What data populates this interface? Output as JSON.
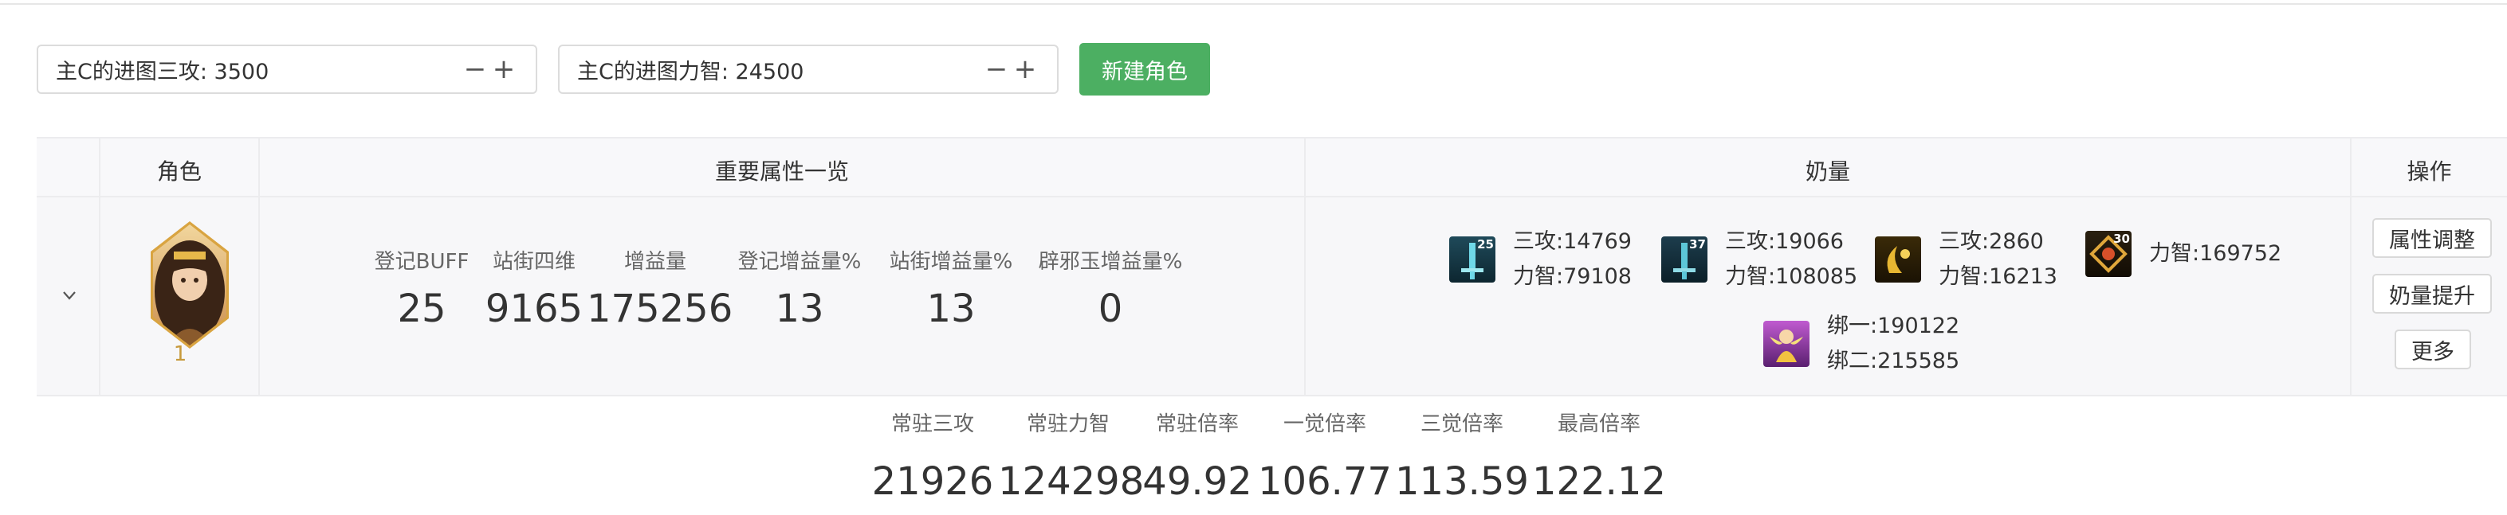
{
  "toolbar": {
    "main_attack_field": {
      "label": "主C的进图三攻: 3500",
      "minus": "−",
      "plus": "+"
    },
    "main_stat_field": {
      "label": "主C的进图力智: 24500",
      "minus": "−",
      "plus": "+"
    },
    "new_role_button": "新建角色",
    "accent_color": "#4caf62"
  },
  "table": {
    "headers": {
      "role": "角色",
      "attributes": "重要属性一览",
      "milk": "奶量",
      "operations": "操作"
    },
    "row": {
      "role_index": "1",
      "stats": [
        {
          "label": "登记BUFF",
          "value": "25"
        },
        {
          "label": "站街四维",
          "value": "9165"
        },
        {
          "label": "增益量",
          "value": "175256"
        },
        {
          "label": "登记增益量%",
          "value": "13"
        },
        {
          "label": "站街增益量%",
          "value": "13"
        },
        {
          "label": "辟邪玉增益量%",
          "value": "0"
        }
      ],
      "milk": {
        "skill1": {
          "level": "25",
          "line1": "三攻:14769",
          "line2": "力智:79108"
        },
        "skill2": {
          "level": "37",
          "line1": "三攻:19066",
          "line2": "力智:108085"
        },
        "skill3": {
          "line1": "三攻:2860",
          "line2": "力智:16213"
        },
        "skill4": {
          "level": "30",
          "line1": "力智:169752"
        },
        "skill5": {
          "line1": "绑一:190122",
          "line2": "绑二:215585"
        }
      },
      "operations": {
        "adjust": "属性调整",
        "boost": "奶量提升",
        "more": "更多"
      }
    }
  },
  "summary": [
    {
      "label": "常驻三攻",
      "value": "21926"
    },
    {
      "label": "常驻力智",
      "value": "124298"
    },
    {
      "label": "常驻倍率",
      "value": "49.92"
    },
    {
      "label": "一觉倍率",
      "value": "106.77"
    },
    {
      "label": "三觉倍率",
      "value": "113.59"
    },
    {
      "label": "最高倍率",
      "value": "122.12"
    }
  ]
}
